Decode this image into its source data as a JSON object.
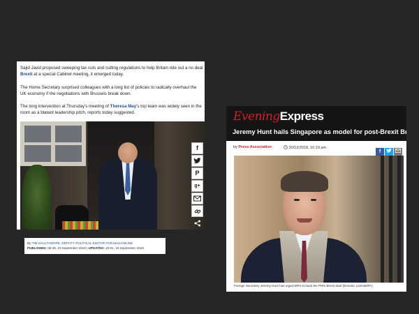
{
  "left_article": {
    "para1_pre": "Sajid Javid proposed sweeping tax cuts and cutting regulations to help Britain ride out a no deal ",
    "para1_link": "Brexit",
    "para1_post": " at a special Cabinet meeting, it emerged today.",
    "para2": "The Home Secretary surprised colleagues with a long list of policies to radically overhaul the UK economy if the negotiations with Brussels break down.",
    "para3_pre": "The long intervention at Thursday's meeting of ",
    "para3_link": "Theresa May",
    "para3_post": "'s top team was widely seen in the room as a blatant leadership pitch, reports today suggested.",
    "share_icons": [
      "facebook-icon",
      "twitter-icon",
      "pinterest-icon",
      "google-plus-icon",
      "email-icon",
      "link-icon",
      "share-icon"
    ],
    "byline": {
      "by_label": "By",
      "author": "TIM SCULTHORPE, DEPUTY POLITICAL EDITOR FOR MAILONLINE",
      "published_label": "PUBLISHED:",
      "published_value": "08:39, 19 September 2018",
      "separator": "|",
      "updated_label": "UPDATED:",
      "updated_value": "10:01, 19 September 2018"
    }
  },
  "right_article": {
    "logo_evening": "Evening",
    "logo_express": "Express",
    "headline": "Jeremy Hunt hails Singapore as model for post-Brexit Britain",
    "source_prefix": "by",
    "source": "Press Association",
    "date": "30/12/2018, 10:19 am",
    "share_icons": [
      "facebook-icon",
      "twitter-icon",
      "email-icon"
    ],
    "caption": "Foreign Secretary Jeremy Hunt has urged MPs to back the PM's Brexit deal (Dominic Lipinski/PA)",
    "colors": {
      "accent_red": "#c4242b",
      "header_bg": "#151515",
      "facebook": "#3b5998",
      "twitter": "#1da1f2",
      "email": "#7a7a7a"
    }
  }
}
